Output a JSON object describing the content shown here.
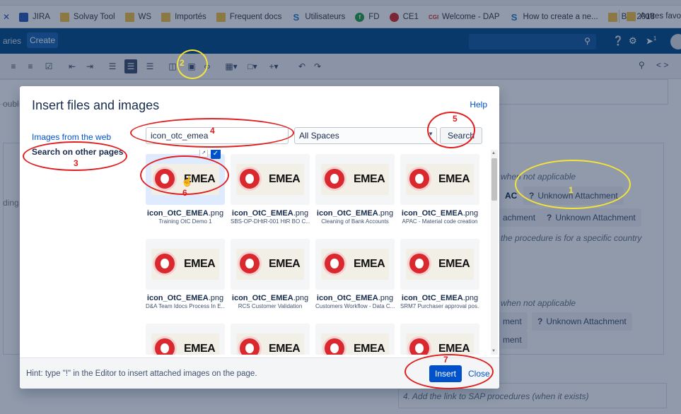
{
  "bookmarks": {
    "items": [
      {
        "label": "JIRA",
        "icon": "jira-icon"
      },
      {
        "label": "Solvay Tool",
        "icon": "folder-icon"
      },
      {
        "label": "WS",
        "icon": "folder-icon"
      },
      {
        "label": "Importés",
        "icon": "folder-icon"
      },
      {
        "label": "Frequent docs",
        "icon": "folder-icon"
      },
      {
        "label": "Utilisateurs",
        "icon": "solvay-icon"
      },
      {
        "label": "FD",
        "icon": "fd-icon"
      },
      {
        "label": "CE1",
        "icon": "ce1-icon"
      },
      {
        "label": "Welcome - DAP",
        "icon": "cgi-icon"
      },
      {
        "label": "How to create a ne...",
        "icon": "solvay-icon"
      },
      {
        "label": "BW 2018",
        "icon": "folder-icon"
      }
    ],
    "other": "Autres favo"
  },
  "appbar": {
    "left_label": "aries",
    "create": "Create",
    "notification_count": "1"
  },
  "toolbar": {
    "right_expand": "< >"
  },
  "background": {
    "when_not_applicable_1": "when not applicable",
    "ac": "AC",
    "chip_unknown_1": "Unknown Attachment",
    "chip_attachment_a": "achment",
    "chip_unknown_2": "Unknown Attachment",
    "procedure_country": "the procedure is for a specific country",
    "when_not_applicable_2": "when not applicable",
    "chip_ment": "ment",
    "chip_unknown_3": "Unknown Attachment",
    "chip_ment2": "ment",
    "sap_link": "4. Add the link to SAP procedures (when it exists)",
    "left_fragment_1": "oubl",
    "left_fragment_2": "ding"
  },
  "dialog": {
    "title": "Insert files and images",
    "help": "Help",
    "side": {
      "web": "Images from the web",
      "other_pages": "Search on other pages"
    },
    "search_value": "icon_otc_emea",
    "space_selected": "All Spaces",
    "search_button": "Search",
    "results": [
      {
        "name": "icon_OtC_EMEA",
        "ext": ".png",
        "page": "Training OtC Demo 1",
        "banner": "EMEA"
      },
      {
        "name": "icon_OtC_EMEA",
        "ext": ".png",
        "page": "SBS-OP-DHtR-001 HtR BO C...",
        "banner": "EMEA"
      },
      {
        "name": "icon_OtC_EMEA",
        "ext": ".png",
        "page": "Cleaning of Bank Accounts",
        "banner": "EMEA"
      },
      {
        "name": "icon_OtC_EMEA",
        "ext": ".png",
        "page": "APAC - Material code creation",
        "banner": "EMEA"
      },
      {
        "name": "icon_OtC_EMEA",
        "ext": ".png",
        "page": "D&A Team Idocs Process In E...",
        "banner": "EMEA"
      },
      {
        "name": "icon_OtC_EMEA",
        "ext": ".png",
        "page": "RCS Customer Validation",
        "banner": "EMEA"
      },
      {
        "name": "icon_OtC_EMEA",
        "ext": ".png",
        "page": "Customers Workflow - Data C...",
        "banner": "EMEA"
      },
      {
        "name": "icon_OtC_EMEA",
        "ext": ".png",
        "page": "SRM7 Purchaser approval pos...",
        "banner": "EMEA"
      },
      {
        "name": "icon_OtC_EMEA",
        "ext": ".png",
        "page": "",
        "banner": "EMEA"
      },
      {
        "name": "icon_OtC_EMEA",
        "ext": ".png",
        "page": "",
        "banner": "EMEA"
      },
      {
        "name": "icon_OtC_EMEA",
        "ext": ".png",
        "page": "",
        "banner": "EMEA"
      },
      {
        "name": "icon_OtC_EMEA",
        "ext": ".png",
        "page": "",
        "banner": "EMEA"
      }
    ],
    "hint": "Hint: type \"!\" in the Editor to insert attached images on the page.",
    "insert": "Insert",
    "close": "Close"
  },
  "annotations": {
    "n1": "1",
    "n2": "2",
    "n3": "3",
    "n4": "4",
    "n5": "5",
    "n6": "6",
    "n7": "7"
  },
  "colors": {
    "header": "#0a4d8c",
    "primary": "#0052cc",
    "annotation_red": "#e02020",
    "annotation_yellow": "#f5e33a"
  }
}
